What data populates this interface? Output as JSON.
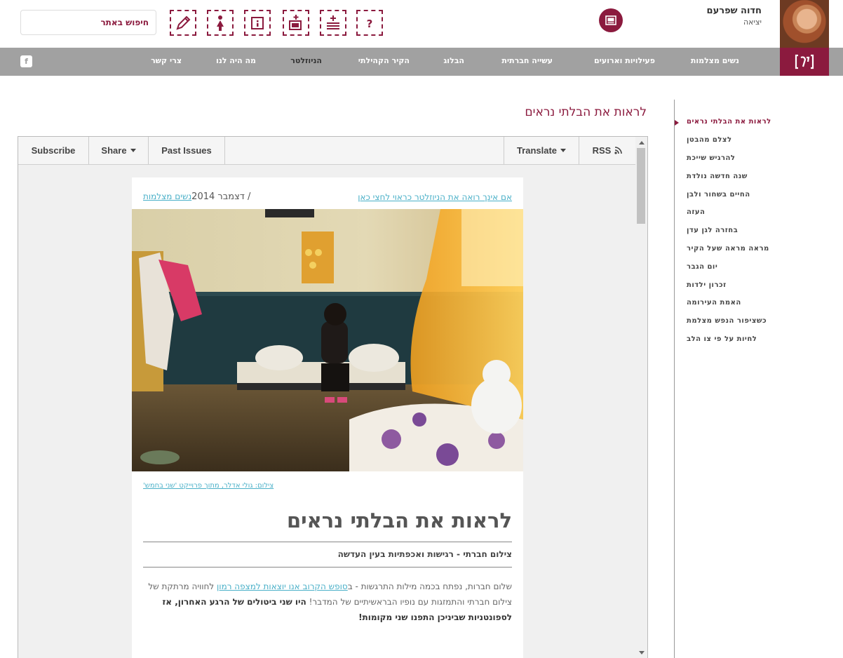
{
  "header": {
    "user_name": "חדוה שפרעם",
    "user_sub": "יציאה",
    "search_placeholder": "חיפוש באתר",
    "tools": [
      "edit-icon",
      "woman-icon",
      "info-frame-icon",
      "add-image-icon",
      "add-list-icon",
      "help-icon"
    ],
    "gallery_icon": "gallery-icon"
  },
  "nav": {
    "items": [
      {
        "label": "נשים מצלמות",
        "active": false
      },
      {
        "label": "פעילויות וארועים",
        "active": false
      },
      {
        "label": "עשייה חברתית",
        "active": false
      },
      {
        "label": "הבלוג",
        "active": false
      },
      {
        "label": "הקיר הקהילתי",
        "active": false
      },
      {
        "label": "הניוזלטר",
        "active": true
      },
      {
        "label": "מה היה לנו",
        "active": false
      },
      {
        "label": "צרי קשר",
        "active": false
      }
    ],
    "facebook": "f",
    "accent": "#8b1a3e"
  },
  "main": {
    "page_title": "לראות את הבלתי נראים"
  },
  "toolbar": {
    "subscribe": "Subscribe",
    "share": "Share",
    "past_issues": "Past Issues",
    "translate": "Translate",
    "rss": "RSS"
  },
  "newsletter": {
    "top_link": "אם אינך רואה את הניוזלטר כראוי לחצי כאן",
    "date_link": "נשים מצלמות",
    "date_text": "/ דצמבר 2014",
    "caption": "צילום: גולי אדלר, מתוך פרוייקט 'שני בחמש'",
    "title": "לראות את הבלתי נראים",
    "subtitle": "צילום חברתי - רגישות ואכפתיות בעין העדשה",
    "body_1": "שלום חברות, נפתח בכמה מילות התרגשות - ב",
    "body_link": "סופש הקרוב אנו יוצאות למצפה רמון",
    "body_2": " לחוויה מרתקת של צילום חברתי והתמזגות עם נופיו הבראשיתיים של המדבר! ",
    "body_bold": "היו שני ביטולים של הרגע האחרון, אז לספונטניות שביניכן התפנו שני מקומות!"
  },
  "sidebar": {
    "items": [
      {
        "label": "לראות את הבלתי נראים",
        "active": true
      },
      {
        "label": "לצלם מהבטן",
        "active": false
      },
      {
        "label": "להרגיש שייכת",
        "active": false
      },
      {
        "label": "שנה חדשה נולדת",
        "active": false
      },
      {
        "label": "החיים בשחור ולבן",
        "active": false
      },
      {
        "label": "העזה",
        "active": false
      },
      {
        "label": "בחזרה לגן עדן",
        "active": false
      },
      {
        "label": "מראה מראה שעל הקיר",
        "active": false
      },
      {
        "label": "יום הגבר",
        "active": false
      },
      {
        "label": "זכרון ילדות",
        "active": false
      },
      {
        "label": "האמת העירומה",
        "active": false
      },
      {
        "label": "כשציפור הנפש מצלמת",
        "active": false
      },
      {
        "label": "לחיות על פי צו הלב",
        "active": false
      }
    ]
  }
}
